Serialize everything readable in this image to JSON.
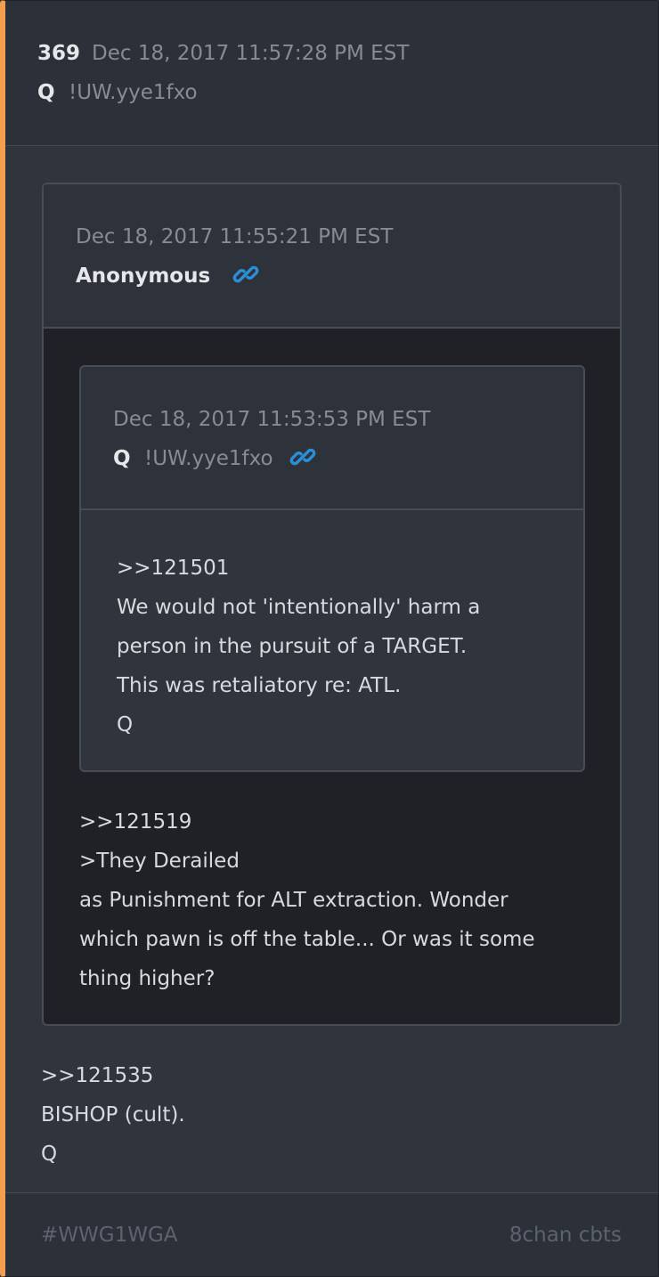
{
  "post": {
    "number": "369",
    "date": "Dec 18, 2017 11:57:28 PM EST",
    "author": "Q",
    "tripcode": "!UW.yye1fxo",
    "body": [
      ">>121535",
      "BISHOP (cult).",
      "Q"
    ]
  },
  "quote1": {
    "date": "Dec 18, 2017 11:55:21 PM EST",
    "author": "Anonymous",
    "link_icon": "link-icon",
    "body": [
      ">>121519",
      ">They Derailed",
      "as Punishment for ALT extraction. Wonder",
      "which pawn is off the table... Or was it some",
      "thing higher?"
    ]
  },
  "quote2": {
    "date": "Dec 18, 2017 11:53:53 PM EST",
    "author": "Q",
    "tripcode": "!UW.yye1fxo",
    "link_icon": "link-icon",
    "body": [
      ">>121501",
      "We would not 'intentionally' harm a",
      "person in the pursuit of a TARGET.",
      "This was retaliatory re: ATL.",
      "Q"
    ]
  },
  "footer": {
    "hashtag": "#WWG1WGA",
    "source": "8chan cbts"
  },
  "colors": {
    "accent": "#f2a04e",
    "link": "#2a8fd6"
  }
}
